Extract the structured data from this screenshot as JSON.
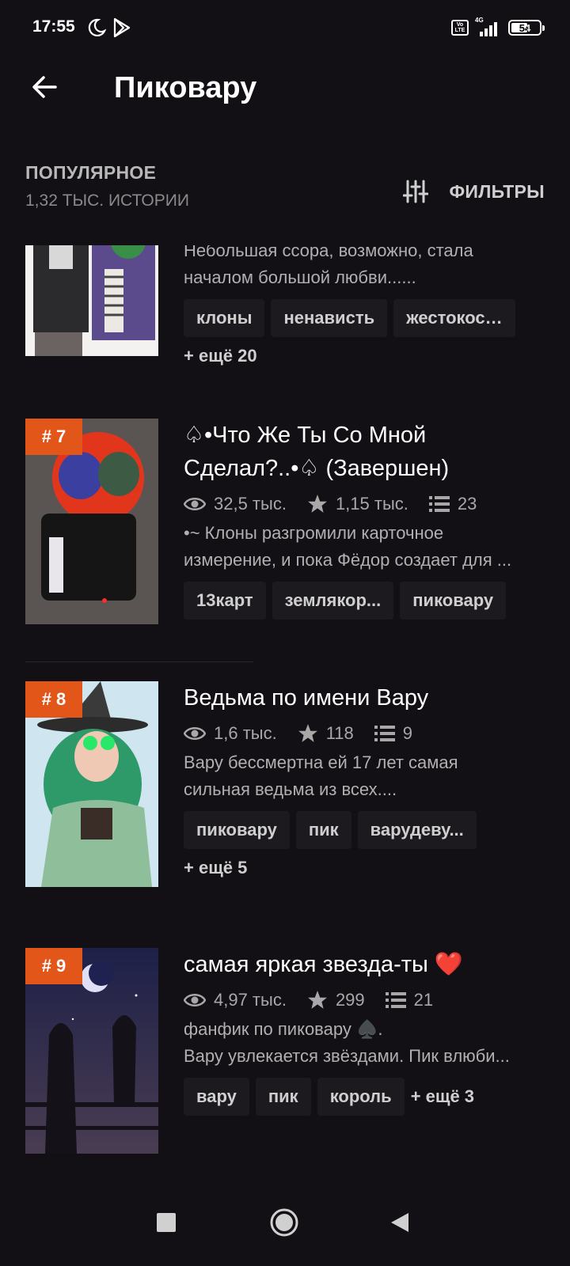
{
  "status_bar": {
    "time": "17:55",
    "volte": "Vo LTE",
    "network": "4G",
    "battery": "54"
  },
  "header": {
    "title": "Пиковару",
    "back_icon": "arrow-left-icon"
  },
  "section": {
    "title": "ПОПУЛЯРНОЕ",
    "count": "1,32 ТЫС. ИСТОРИИ",
    "filters_label": "ФИЛЬТРЫ"
  },
  "stories": [
    {
      "desc_line1": "Небольшая ссора, возможно, стала",
      "desc_line2": "началом большой любви......",
      "tags": [
        "клоны",
        "ненависть",
        "жестокость"
      ],
      "more": "+ ещё 20"
    },
    {
      "rank": "# 7",
      "title_line1": "♤•Что Же Ты Со Мной",
      "title_line2": "Сделал?..•♤ (Завершен)",
      "reads": "32,5 тыс.",
      "votes": "1,15 тыс.",
      "parts": "23",
      "desc_line1": "•~ Клоны разгромили карточное",
      "desc_line2": "измерение, и пока Фёдор создает для ...",
      "tags": [
        "13карт",
        "землякор...",
        "пиковару"
      ]
    },
    {
      "rank": "# 8",
      "title": "Ведьма по имени Вару",
      "reads": "1,6 тыс.",
      "votes": "118",
      "parts": "9",
      "desc_line1": "Вару бессмертна ей 17 лет самая",
      "desc_line2": "сильная ведьма из всех....",
      "tags": [
        "пиковару",
        "пик",
        "варудеву..."
      ],
      "more": "+ ещё 5"
    },
    {
      "rank": "# 9",
      "title": "самая яркая звезда-ты ❤️",
      "reads": "4,97 тыс.",
      "votes": "299",
      "parts": "21",
      "desc_line1": "фанфик по пиковару ♠️.",
      "desc_line2": "Вару увлекается звёздами. Пик влюби...",
      "tags": [
        "вару",
        "пик",
        "король"
      ],
      "more": "+ ещё 3"
    }
  ],
  "colors": {
    "background": "#121014",
    "rank_badge": "#e2561a",
    "text_secondary": "#a8a8a8"
  },
  "nav": {
    "recent_icon": "square-icon",
    "home_icon": "circle-icon",
    "back_icon": "triangle-left-icon"
  }
}
